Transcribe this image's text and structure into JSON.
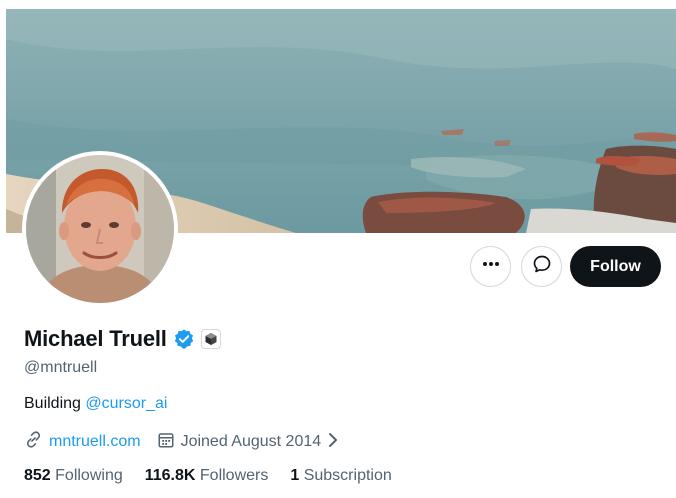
{
  "profile": {
    "name": "Michael Truell",
    "handle": "@mntruell",
    "bio_prefix": "Building ",
    "bio_mention": "@cursor_ai",
    "website": "mntruell.com",
    "joined": "Joined August 2014"
  },
  "actions": {
    "follow_label": "Follow"
  },
  "stats": {
    "following_count": "852",
    "following_label": " Following",
    "followers_count": "116.8K",
    "followers_label": " Followers",
    "subscriptions_count": "1",
    "subscriptions_label": " Subscription"
  },
  "icons": {
    "more": "more-icon",
    "message": "message-icon",
    "verified": "verified-badge-icon",
    "affiliate": "affiliate-badge-icon",
    "link": "link-icon",
    "calendar": "calendar-icon",
    "chevron": "chevron-right-icon"
  },
  "colors": {
    "accent": "#1d9bf0",
    "follow_bg": "#0f1419",
    "secondary_text": "#536471"
  }
}
